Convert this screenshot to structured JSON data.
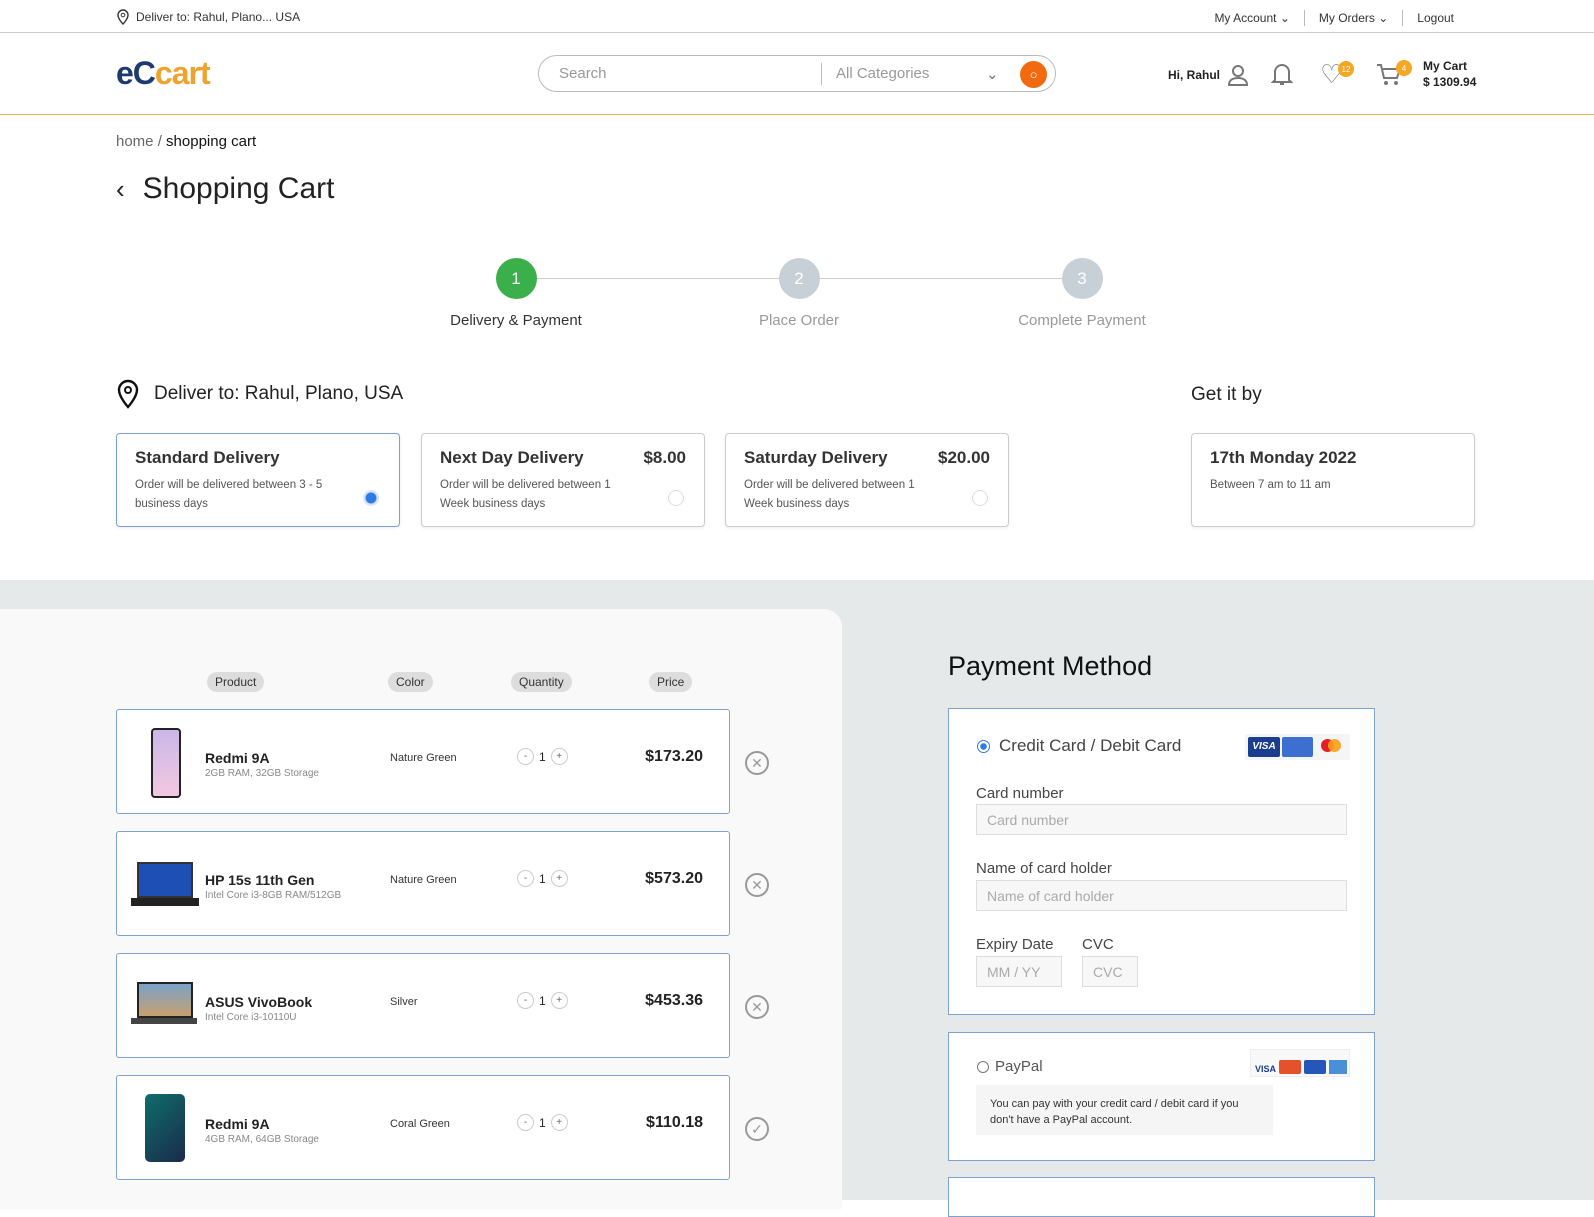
{
  "topbar": {
    "deliver": "Deliver to: Rahul, Plano... USA",
    "my_account": "My Account",
    "my_orders": "My Orders",
    "logout": "Logout"
  },
  "header": {
    "logo_a": "eC",
    "logo_b": "cart",
    "search_placeholder": "Search",
    "category": "All Categories",
    "greeting": "Hi, Rahul",
    "wishlist_count": "12",
    "cart_count": "4",
    "cart_label": "My Cart",
    "cart_total": "$ 1309.94"
  },
  "breadcrumb": {
    "home": "home",
    "sep": "/",
    "current": "shopping cart"
  },
  "page_title": "Shopping Cart",
  "steps": [
    {
      "num": "1",
      "label": "Delivery & Payment"
    },
    {
      "num": "2",
      "label": "Place Order"
    },
    {
      "num": "3",
      "label": "Complete Payment"
    }
  ],
  "delivery": {
    "heading": "Deliver to: Rahul, Plano, USA",
    "get_it_by": "Get it by",
    "options": [
      {
        "title": "Standard Delivery",
        "price": "",
        "desc": "Order will be delivered between 3 - 5 business days",
        "selected": true
      },
      {
        "title": "Next Day Delivery",
        "price": "$8.00",
        "desc": "Order will be delivered between 1 Week business days",
        "selected": false
      },
      {
        "title": "Saturday Delivery",
        "price": "$20.00",
        "desc": "Order will be delivered between 1 Week business days",
        "selected": false
      }
    ],
    "date": "17th Monday 2022",
    "time": "Between 7 am to 11 am"
  },
  "cart": {
    "headers": [
      "Product",
      "Color",
      "Quantity",
      "Price"
    ],
    "items": [
      {
        "name": "Redmi 9A",
        "spec": "2GB RAM, 32GB Storage",
        "color": "Nature Green",
        "qty": "1",
        "price": "$173.20",
        "action": "remove"
      },
      {
        "name": "HP 15s 11th Gen",
        "spec": "Intel Core i3-8GB RAM/512GB",
        "color": "Nature Green",
        "qty": "1",
        "price": "$573.20",
        "action": "remove"
      },
      {
        "name": "ASUS VivoBook",
        "spec": "Intel Core i3-10110U",
        "color": "Silver",
        "qty": "1",
        "price": "$453.36",
        "action": "remove"
      },
      {
        "name": "Redmi 9A",
        "spec": "4GB RAM, 64GB Storage",
        "color": "Coral Green",
        "qty": "1",
        "price": "$110.18",
        "action": "confirmed"
      }
    ]
  },
  "payment": {
    "title": "Payment Method",
    "card_option": "Credit Card / Debit Card",
    "card_number_label": "Card number",
    "card_number_placeholder": "Card number",
    "holder_label": "Name of card holder",
    "holder_placeholder": "Name of card holder",
    "expiry_label": "Expiry Date",
    "expiry_placeholder": "MM / YY",
    "cvc_label": "CVC",
    "cvc_placeholder": "CVC",
    "paypal_option": "PayPal",
    "paypal_note": "You can pay with your credit card / debit card if you don't have a PayPal account.",
    "visa": "VISA"
  },
  "colors": {
    "accent": "#f26a0f",
    "brand_dark": "#1e3a6e",
    "brand_light": "#f0a32c",
    "step_active": "#3bb04a",
    "selected": "#2f7be5"
  }
}
